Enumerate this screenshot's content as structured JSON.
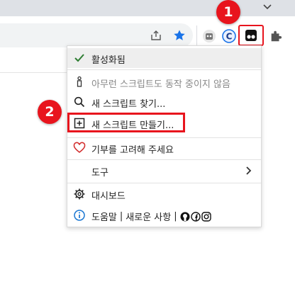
{
  "badges": {
    "one": "1",
    "two": "2"
  },
  "menu": {
    "enabled": "활성화됨",
    "no_scripts": "아무런 스크립트도 동작 중이지 않음",
    "find_script": "새 스크립트 찾기...",
    "create_script": "새 스크립트 만들기...",
    "donate": "기부를 고려해 주세요",
    "utilities": "도구",
    "dashboard": "대시보드",
    "help": "도움말",
    "changelog": "새로운 사항",
    "separator": "|"
  },
  "icons": {
    "chevron": "chevron-down-icon",
    "share": "share-icon",
    "star": "bookmark-star-icon",
    "profile": "robot-extension-icon",
    "cext": "c-extension-icon",
    "tampermonkey": "tampermonkey-icon",
    "puzzle": "extensions-puzzle-icon"
  },
  "colors": {
    "annotation_red": "#e8141d",
    "star_blue": "#1a73e8",
    "check_green": "#2e7d32",
    "heart_red": "#d32f2f",
    "info_blue": "#1976d2"
  }
}
